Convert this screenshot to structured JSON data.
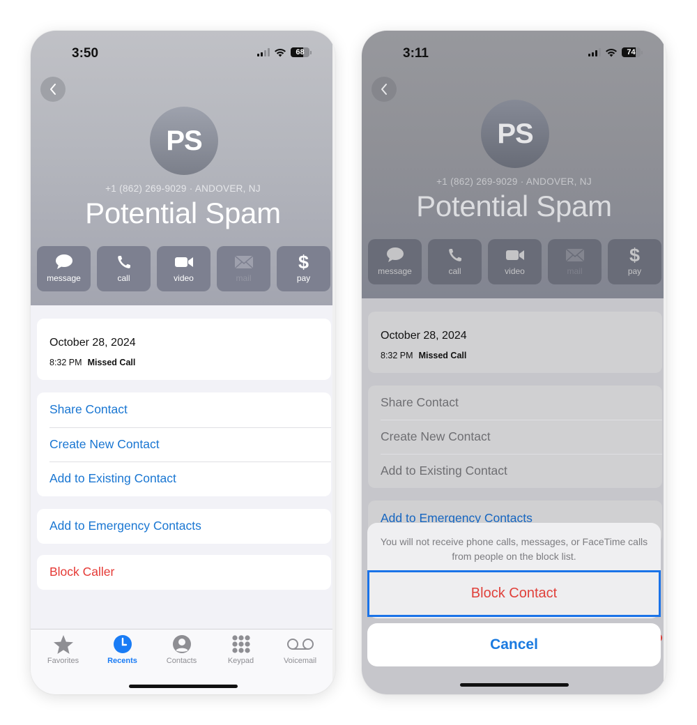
{
  "left_phone": {
    "status": {
      "time": "3:50",
      "battery": "68",
      "battery_level_percent": 68,
      "signal_bars_active": 2
    },
    "header": {
      "avatar_initials": "PS",
      "subtitle": "+1 (862) 269-9029 · ANDOVER, NJ",
      "name": "Potential Spam",
      "actions": [
        {
          "label": "message",
          "icon": "message-bubble-icon",
          "enabled": true
        },
        {
          "label": "call",
          "icon": "phone-icon",
          "enabled": true
        },
        {
          "label": "video",
          "icon": "video-camera-icon",
          "enabled": true
        },
        {
          "label": "mail",
          "icon": "envelope-icon",
          "enabled": false
        },
        {
          "label": "pay",
          "icon": "dollar-icon",
          "enabled": true
        }
      ]
    },
    "call_log": {
      "date": "October 28, 2024",
      "time": "8:32 PM",
      "type": "Missed Call"
    },
    "contact_options": [
      "Share Contact",
      "Create New Contact",
      "Add to Existing Contact"
    ],
    "emergency_option": "Add to Emergency Contacts",
    "block_option": "Block Caller",
    "tabbar": {
      "tabs": [
        {
          "label": "Favorites",
          "icon": "star-icon",
          "active": false
        },
        {
          "label": "Recents",
          "icon": "clock-icon",
          "active": true
        },
        {
          "label": "Contacts",
          "icon": "person-circle-icon",
          "active": false
        },
        {
          "label": "Keypad",
          "icon": "keypad-icon",
          "active": false
        },
        {
          "label": "Voicemail",
          "icon": "voicemail-icon",
          "active": false
        }
      ]
    }
  },
  "right_phone": {
    "status": {
      "time": "3:11",
      "battery": "74",
      "battery_level_percent": 74,
      "signal_bars_active": 3
    },
    "header": {
      "avatar_initials": "PS",
      "subtitle": "+1 (862) 269-9029 · ANDOVER, NJ",
      "name": "Potential Spam",
      "actions": [
        {
          "label": "message",
          "icon": "message-bubble-icon",
          "enabled": true
        },
        {
          "label": "call",
          "icon": "phone-icon",
          "enabled": true
        },
        {
          "label": "video",
          "icon": "video-camera-icon",
          "enabled": true
        },
        {
          "label": "mail",
          "icon": "envelope-icon",
          "enabled": false
        },
        {
          "label": "pay",
          "icon": "dollar-icon",
          "enabled": true
        }
      ]
    },
    "call_log": {
      "date": "October 28, 2024",
      "time": "8:32 PM",
      "type": "Missed Call"
    },
    "contact_options": [
      "Share Contact",
      "Create New Contact",
      "Add to Existing Contact"
    ],
    "emergency_option": "Add to Emergency Contacts",
    "action_sheet": {
      "message": "You will not receive phone calls, messages, or FaceTime calls from people on the block list.",
      "block_label": "Block Contact",
      "cancel_label": "Cancel"
    }
  },
  "colors": {
    "link_blue": "#1976d2",
    "destructive_red": "#e53935",
    "active_tab_blue": "#1a7cf5",
    "highlight_border": "#1a73e8"
  }
}
